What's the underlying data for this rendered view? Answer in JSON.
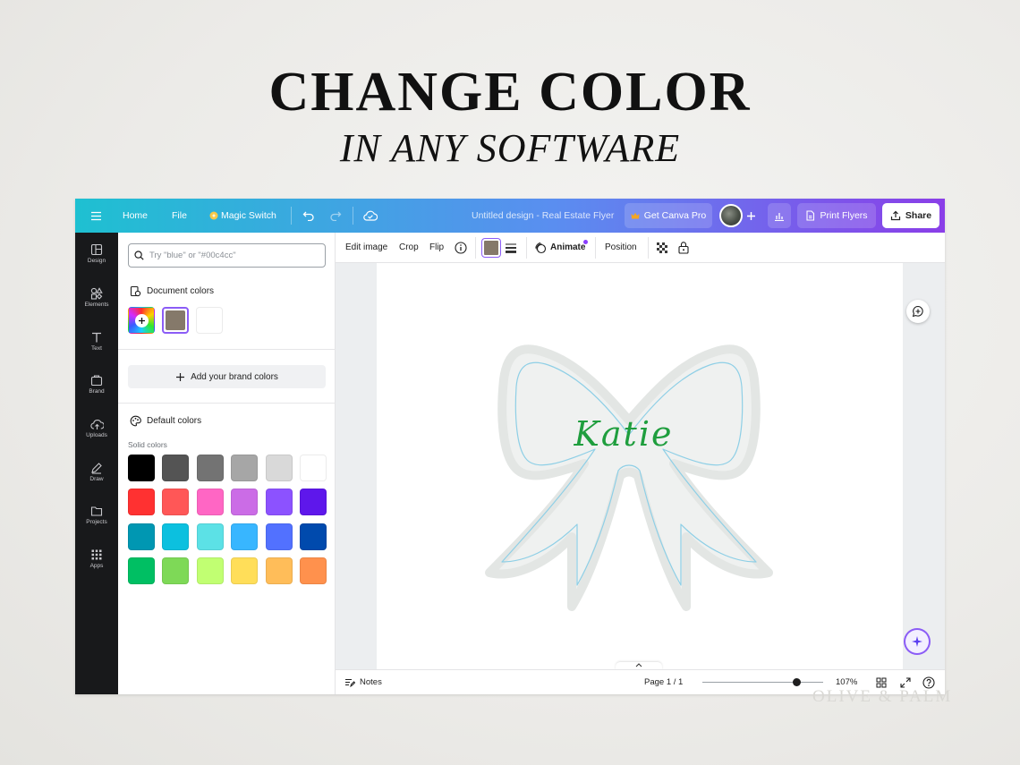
{
  "promo": {
    "headline": "CHANGE COLOR",
    "subline": "IN ANY SOFTWARE",
    "watermark": "OLIVE & PALM"
  },
  "topbar": {
    "menu_icon": "hamburger-icon",
    "home": "Home",
    "file": "File",
    "magic_switch": "Magic Switch",
    "doc_title": "Untitled design - Real Estate Flyer",
    "get_pro": "Get Canva Pro",
    "print": "Print Flyers",
    "share": "Share",
    "gradient_start": "#1ec0d1",
    "gradient_end": "#8a3ee8"
  },
  "rail": {
    "items": [
      {
        "label": "Design",
        "icon": "layout-icon"
      },
      {
        "label": "Elements",
        "icon": "shapes-icon"
      },
      {
        "label": "Text",
        "icon": "text-icon"
      },
      {
        "label": "Brand",
        "icon": "brand-icon"
      },
      {
        "label": "Uploads",
        "icon": "cloud-upload-icon"
      },
      {
        "label": "Draw",
        "icon": "pen-icon"
      },
      {
        "label": "Projects",
        "icon": "folder-icon"
      },
      {
        "label": "Apps",
        "icon": "grid-icon"
      }
    ]
  },
  "panel": {
    "search_placeholder": "Try \"blue\" or \"#00c4cc\"",
    "document_colors_title": "Document colors",
    "document_colors": [
      "#85796a",
      "#ffffff"
    ],
    "add_brand": "Add your brand colors",
    "default_colors_title": "Default colors",
    "solid_label": "Solid colors",
    "solid_colors": [
      [
        "#000000",
        "#545454",
        "#737373",
        "#a6a6a6",
        "#d9d9d9",
        "#ffffff"
      ],
      [
        "#ff3131",
        "#ff5757",
        "#ff66c4",
        "#cb6ce6",
        "#8c52ff",
        "#5e17eb"
      ],
      [
        "#0097b2",
        "#0cc0df",
        "#5ce1e6",
        "#38b6ff",
        "#5271ff",
        "#004aad"
      ],
      [
        "#00bf63",
        "#7ed957",
        "#c1ff72",
        "#ffde59",
        "#ffbd59",
        "#ff914d"
      ]
    ]
  },
  "toolbar": {
    "edit_image": "Edit image",
    "crop": "Crop",
    "flip": "Flip",
    "current_color": "#85796a",
    "animate": "Animate",
    "position": "Position"
  },
  "design": {
    "name_text": "Katie",
    "name_color": "#1f9e3e",
    "bow_fill": "#eff1f0",
    "bow_outline": "#8ecfe6"
  },
  "bottombar": {
    "notes": "Notes",
    "page": "Page 1 / 1",
    "zoom": "107%",
    "zoom_level": 0.78
  }
}
